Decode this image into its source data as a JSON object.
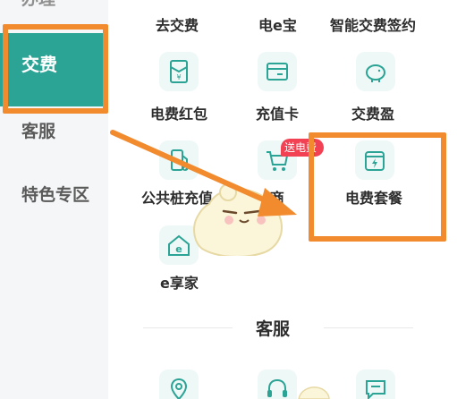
{
  "sidebar": {
    "items": [
      {
        "label": "办理"
      },
      {
        "label": "交费"
      },
      {
        "label": "客服"
      },
      {
        "label": "特色专区"
      }
    ]
  },
  "services": {
    "row1": [
      "去交费",
      "电e宝",
      "智能交费签约"
    ],
    "row2": [
      "电费红包",
      "充值卡",
      "交费盈"
    ],
    "row3": [
      "公共桩充值",
      "e商",
      "电费套餐"
    ],
    "row4": [
      "e享家"
    ],
    "badge": "送电费"
  },
  "section": {
    "title": "客服"
  },
  "colors": {
    "accent": "#2ba395",
    "highlight": "#f28a2e",
    "badge": "#f24153",
    "icon_bg": "#eef8f6"
  }
}
